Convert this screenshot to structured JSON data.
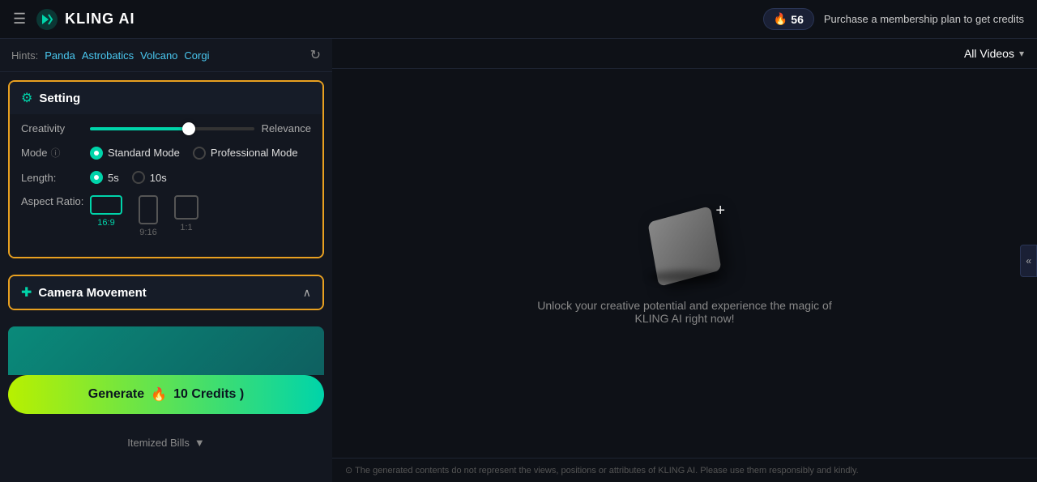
{
  "header": {
    "menu_label": "☰",
    "logo_text": "KLING AI",
    "credits_count": "56",
    "purchase_text": "Purchase a membership plan to get credits"
  },
  "hints": {
    "label": "Hints:",
    "tags": [
      "Panda",
      "Astrobatics",
      "Volcano",
      "Corgi"
    ],
    "refresh_title": "Refresh hints"
  },
  "settings": {
    "title": "Setting",
    "creativity_label": "Creativity",
    "relevance_label": "Relevance",
    "slider_value": 60,
    "mode_label": "Mode",
    "standard_mode_label": "Standard Mode",
    "professional_mode_label": "Professional Mode",
    "length_label": "Length:",
    "length_5s": "5s",
    "length_10s": "10s",
    "aspect_label": "Aspect Ratio:",
    "aspect_options": [
      {
        "label": "16:9",
        "active": true
      },
      {
        "label": "9:16",
        "active": false
      },
      {
        "label": "1:1",
        "active": false
      }
    ]
  },
  "camera": {
    "title": "Camera Movement",
    "collapsed": false
  },
  "generate": {
    "label": "Generate",
    "credits_icon": "🔥",
    "credits_text": "10 Credits )"
  },
  "itemized": {
    "label": "Itemized Bills",
    "icon": "▼"
  },
  "videos": {
    "all_videos_label": "All Videos",
    "dropdown_icon": "▾"
  },
  "content": {
    "unlock_text": "Unlock your creative potential and experience the magic of KLING AI right now!"
  },
  "footer": {
    "hint_text": "⊙ The generated contents do not represent the views, positions or attributes of KLING AI. Please use them responsibly and kindly."
  }
}
